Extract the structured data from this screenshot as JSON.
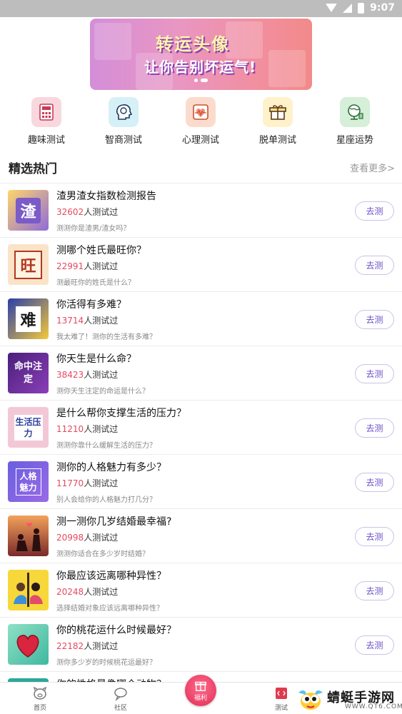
{
  "status_bar": {
    "time": "9:07"
  },
  "banner": {
    "title": "转运头像",
    "subtitle": "让你告别坏运气!"
  },
  "categories": [
    {
      "label": "趣味测试",
      "icon": "calculator-icon",
      "color": "#f9d7df"
    },
    {
      "label": "智商测试",
      "icon": "brain-icon",
      "color": "#d6f0f7"
    },
    {
      "label": "心理测试",
      "icon": "heartbeat-icon",
      "color": "#fbdccc"
    },
    {
      "label": "脱单测试",
      "icon": "giftbox-icon",
      "color": "#fff1c9"
    },
    {
      "label": "星座运势",
      "icon": "globe-icon",
      "color": "#d5efd9"
    }
  ],
  "section": {
    "title": "精选热门",
    "more": "查看更多>"
  },
  "items": [
    {
      "title": "渣男渣女指数检测报告",
      "count": "32602",
      "count_suffix": "人测试过",
      "desc": "测测你是渣男/渣女吗？",
      "button": "去测",
      "thumb_text": "渣"
    },
    {
      "title": "测哪个姓氏最旺你？",
      "count": "22991",
      "count_suffix": "人测试过",
      "desc": "测最旺你的姓氏是什么？",
      "button": "去测",
      "thumb_text": "旺"
    },
    {
      "title": "你活得有多难？",
      "count": "13714",
      "count_suffix": "人测试过",
      "desc": "我太难了！测你的生活有多难？",
      "button": "去测",
      "thumb_text": "难"
    },
    {
      "title": "你天生是什么命？",
      "count": "38423",
      "count_suffix": "人测试过",
      "desc": "测你天生注定的命运是什么？",
      "button": "去测",
      "thumb_text": "命中注定"
    },
    {
      "title": "是什么帮你支撑生活的压力？",
      "count": "11210",
      "count_suffix": "人测试过",
      "desc": "测测你靠什么缓解生活的压力？",
      "button": "去测",
      "thumb_text": "生活压力"
    },
    {
      "title": "测你的人格魅力有多少？",
      "count": "11770",
      "count_suffix": "人测试过",
      "desc": "别人会给你的人格魅力打几分？",
      "button": "去测",
      "thumb_text": "人格魅力"
    },
    {
      "title": "测一测你几岁结婚最幸福?",
      "count": "20998",
      "count_suffix": "人测试过",
      "desc": "测测你适合在多少岁时结婚？",
      "button": "去测",
      "thumb_text": ""
    },
    {
      "title": "你最应该远离哪种异性？",
      "count": "20248",
      "count_suffix": "人测试过",
      "desc": "选择结婚对象应该远离哪种异性？",
      "button": "去测",
      "thumb_text": ""
    },
    {
      "title": "你的桃花运什么时候最好？",
      "count": "22182",
      "count_suffix": "人测试过",
      "desc": "测你多少岁的时候桃花运最好？",
      "button": "去测",
      "thumb_text": ""
    },
    {
      "title": "你的性格最像哪个动物？",
      "count": "",
      "count_suffix": "",
      "desc": "",
      "button": "",
      "thumb_text": ""
    }
  ],
  "tabbar": {
    "home": "首页",
    "community": "社区",
    "welfare": "福利",
    "test": "测试"
  },
  "watermark": {
    "name": "蜻蜓手游网",
    "url": "WWW.QT6.COM"
  }
}
